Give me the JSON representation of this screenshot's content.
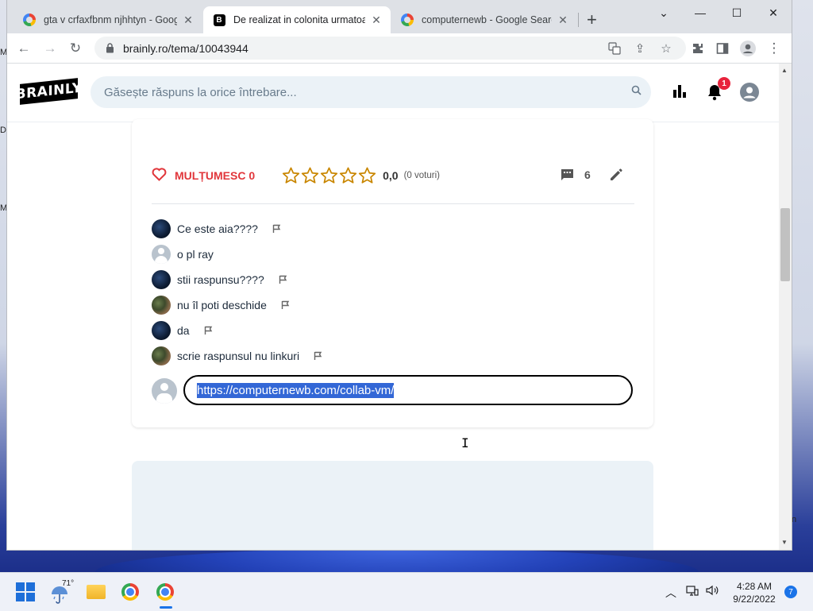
{
  "browser": {
    "tabs": [
      {
        "title": "gta v crfaxfbnm njhhtyn - Google",
        "favicon": "google-icon"
      },
      {
        "title": "De realizat in colonita urmatoare",
        "favicon": "brainly-icon"
      },
      {
        "title": "computernewb - Google Search",
        "favicon": "google-icon"
      }
    ],
    "url": "brainly.ro/tema/10043944"
  },
  "header": {
    "logo": "BRAINLY",
    "search_placeholder": "Găsește răspuns la orice întrebare...",
    "notification_count": "1"
  },
  "answer": {
    "thanks_label": "MULȚUMESC 0",
    "rating": "0,0",
    "votes": "(0 voturi)",
    "comment_count": "6"
  },
  "comments": [
    {
      "text": "Ce este aia????",
      "avatar": "dark"
    },
    {
      "text": "o pl ray",
      "avatar": "default"
    },
    {
      "text": "stii raspunsu????",
      "avatar": "dark"
    },
    {
      "text": "nu îl poti deschide",
      "avatar": "photo"
    },
    {
      "text": "da",
      "avatar": "dark"
    },
    {
      "text": "scrie raspunsul nu linkuri",
      "avatar": "photo"
    }
  ],
  "compose": {
    "value": "https://computernewb.com/collab-vm/"
  },
  "taskbar": {
    "weather_temp": "71°",
    "time": "4:28 AM",
    "date": "9/22/2022",
    "notification_count": "7"
  },
  "colors": {
    "accent_red": "#e1363b",
    "star_gold": "#c98600",
    "selection": "#3367d6",
    "search_bg": "#ebf2f7"
  }
}
